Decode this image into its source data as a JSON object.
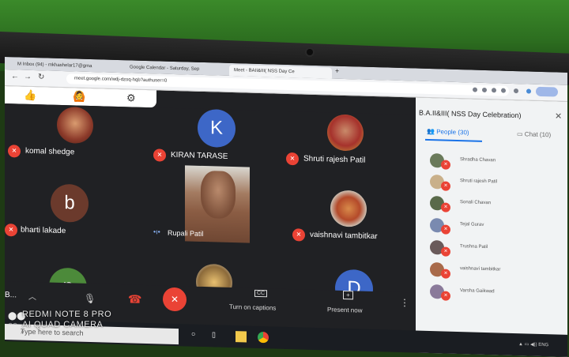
{
  "browser": {
    "tabs": [
      {
        "label": "M  Inbox (94) - mkhashelar17@gma"
      },
      {
        "label": "Google Calendar - Saturday, Sep"
      },
      {
        "label": "Meet - BAII&III( NSS Day Ce"
      }
    ],
    "url": "meet.google.com/wdj-dzoq-hqb?authuser=0"
  },
  "reactions": {
    "items": [
      "thumbs-up-icon",
      "emoji-icon",
      "settings-icon"
    ]
  },
  "grid": {
    "participants": [
      {
        "name": "komal shedge",
        "type": "photo",
        "muted": true
      },
      {
        "name": "KIRAN TARASE",
        "type": "letter",
        "letter": "K",
        "color": "#3d67c7",
        "muted": true
      },
      {
        "name": "Shruti rajesh Patil",
        "type": "photo",
        "muted": true
      },
      {
        "name": "bharti lakade",
        "type": "letter",
        "letter": "b",
        "color": "#6b3a2c",
        "muted": true
      },
      {
        "name": "Rupali Patil",
        "type": "video",
        "muted": false
      },
      {
        "name": "vaishnavi tambitkar",
        "type": "photo",
        "muted": true
      },
      {
        "name": "",
        "type": "letter",
        "letter": "n",
        "color": "#4c8a3a",
        "muted": true
      },
      {
        "name": "",
        "type": "photo",
        "muted": true
      },
      {
        "name": "",
        "type": "letter",
        "letter": "D",
        "color": "#3d67c7",
        "muted": true
      }
    ]
  },
  "panel": {
    "title": "B.A.II&III( NSS Day Celebration)",
    "tab_people": "People (30)",
    "tab_chat": "Chat (10)",
    "people": [
      "Shradha Chavan",
      "Shruti rajesh Patil",
      "Sonali Chavan",
      "Tejal Gurav",
      "Trushna Patil",
      "vaishnavi tambitkar",
      "Varsha Gaikwad"
    ]
  },
  "controls": {
    "meeting_code": "B...",
    "captions_label": "Turn on captions",
    "captions_icon": "CC",
    "present_label": "Present now"
  },
  "taskbar": {
    "search_placeholder": "Type here to search"
  },
  "watermark": {
    "line1": "REDMI NOTE 8 PRO",
    "line2": "AI QUAD CAMERA"
  },
  "colors": {
    "mute": "#ea4335",
    "accent": "#1a73e8",
    "meet_bg": "#202124"
  }
}
